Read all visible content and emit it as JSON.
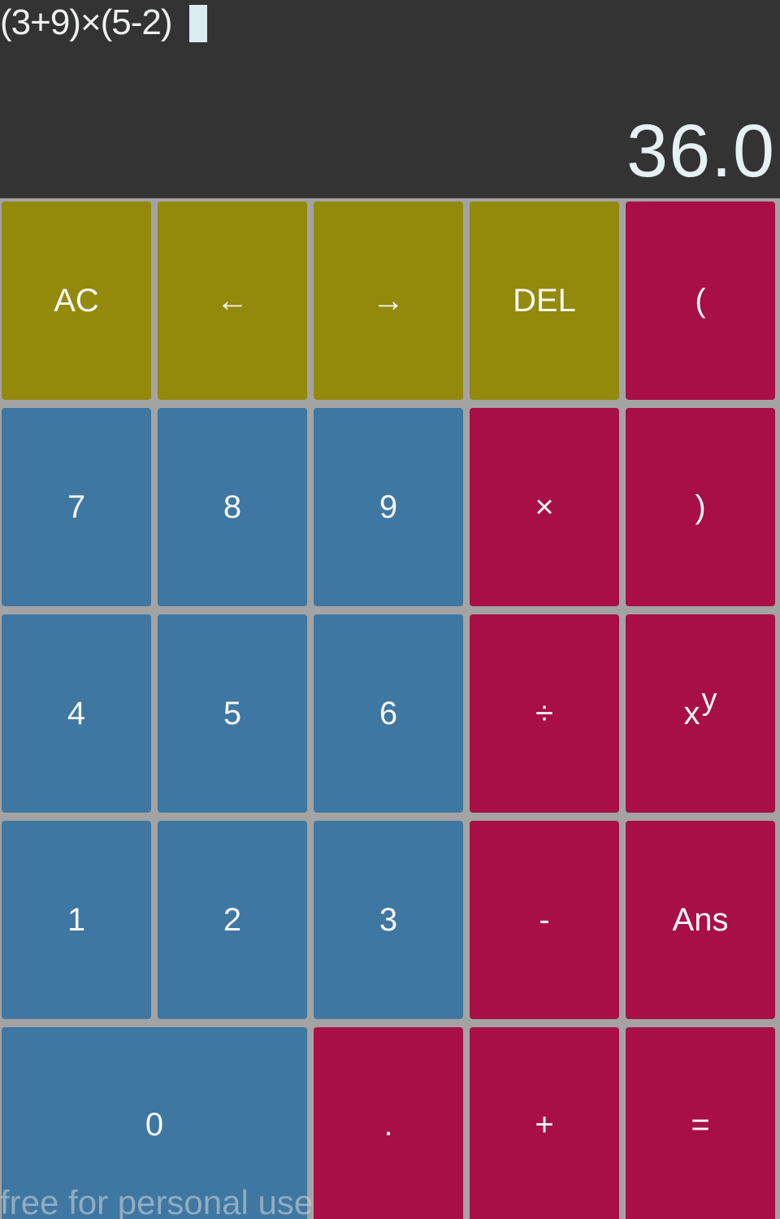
{
  "display": {
    "expression": "(3+9)×(5-2)",
    "result": "36.0"
  },
  "keys": {
    "ac": "AC",
    "cursor_left": "←",
    "cursor_right": "→",
    "del": "DEL",
    "open_paren": "(",
    "seven": "7",
    "eight": "8",
    "nine": "9",
    "multiply": "×",
    "close_paren": ")",
    "four": "4",
    "five": "5",
    "six": "6",
    "divide": "÷",
    "power_base": "x",
    "power_exp": "y",
    "one": "1",
    "two": "2",
    "three": "3",
    "minus": "-",
    "ans": "Ans",
    "zero": "0",
    "decimal": ".",
    "plus": "+",
    "equals": "="
  },
  "watermark": "free for personal use",
  "colors": {
    "display_bg": "#333333",
    "control_keys": "#93890b",
    "digit_keys": "#3e77a2",
    "operator_keys": "#a80f45",
    "grid_gap": "#a3a3a3"
  }
}
